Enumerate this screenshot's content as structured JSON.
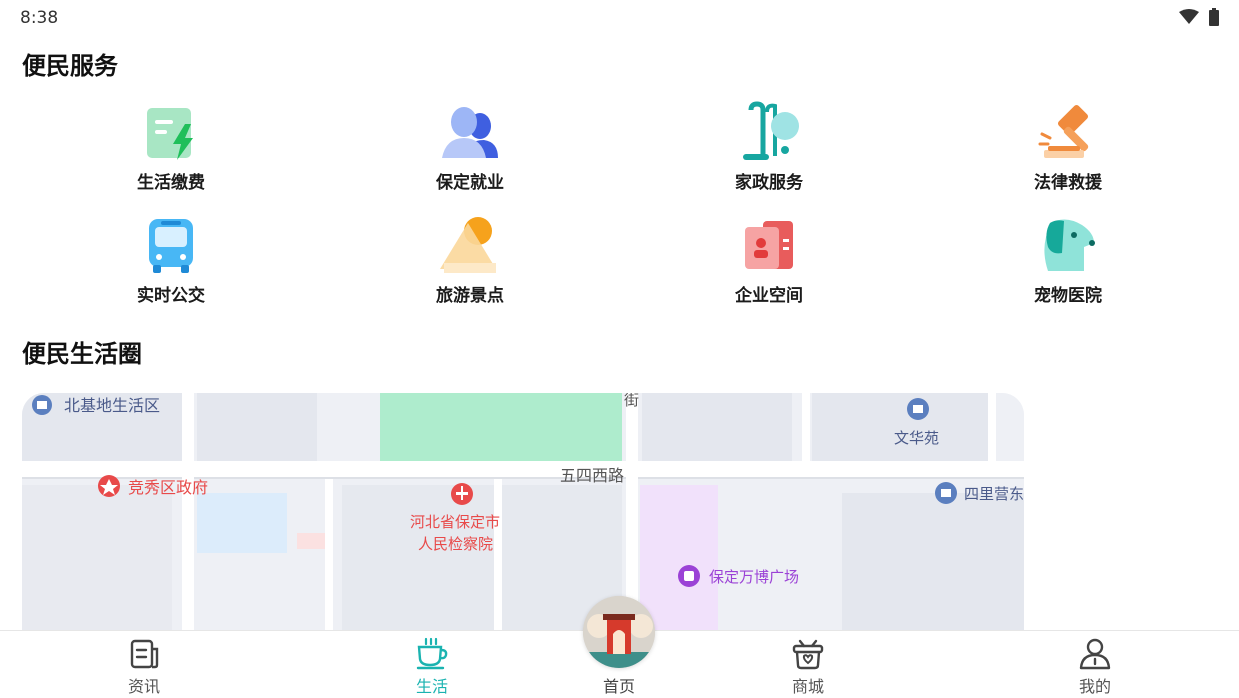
{
  "status": {
    "time": "8:38"
  },
  "sections": {
    "services_title": "便民服务",
    "circle_title": "便民生活圈"
  },
  "services": [
    {
      "label": "生活缴费",
      "icon": "payment-bolt-icon"
    },
    {
      "label": "保定就业",
      "icon": "people-employment-icon"
    },
    {
      "label": "家政服务",
      "icon": "housekeeping-vacuum-icon"
    },
    {
      "label": "法律救援",
      "icon": "gavel-icon"
    },
    {
      "label": "实时公交",
      "icon": "bus-icon"
    },
    {
      "label": "旅游景点",
      "icon": "mountain-sun-icon"
    },
    {
      "label": "企业空间",
      "icon": "enterprise-card-icon"
    },
    {
      "label": "宠物医院",
      "icon": "pet-dog-icon"
    }
  ],
  "map": {
    "labels": {
      "north_base": "北基地生活区",
      "jie": "街",
      "wenhuayuan": "文华苑",
      "road": "五四西路",
      "jingxiu": "竞秀区政府",
      "procuratorate_1": "河北省保定市",
      "procuratorate_2": "人民检察院",
      "silijing": "四里营东",
      "wanbo": "保定万博广场"
    }
  },
  "tabs": {
    "news": "资讯",
    "life": "生活",
    "home": "首页",
    "mall": "商城",
    "mine": "我的"
  },
  "colors": {
    "accent": "#1ab3b0",
    "tab_inactive": "#555555"
  }
}
